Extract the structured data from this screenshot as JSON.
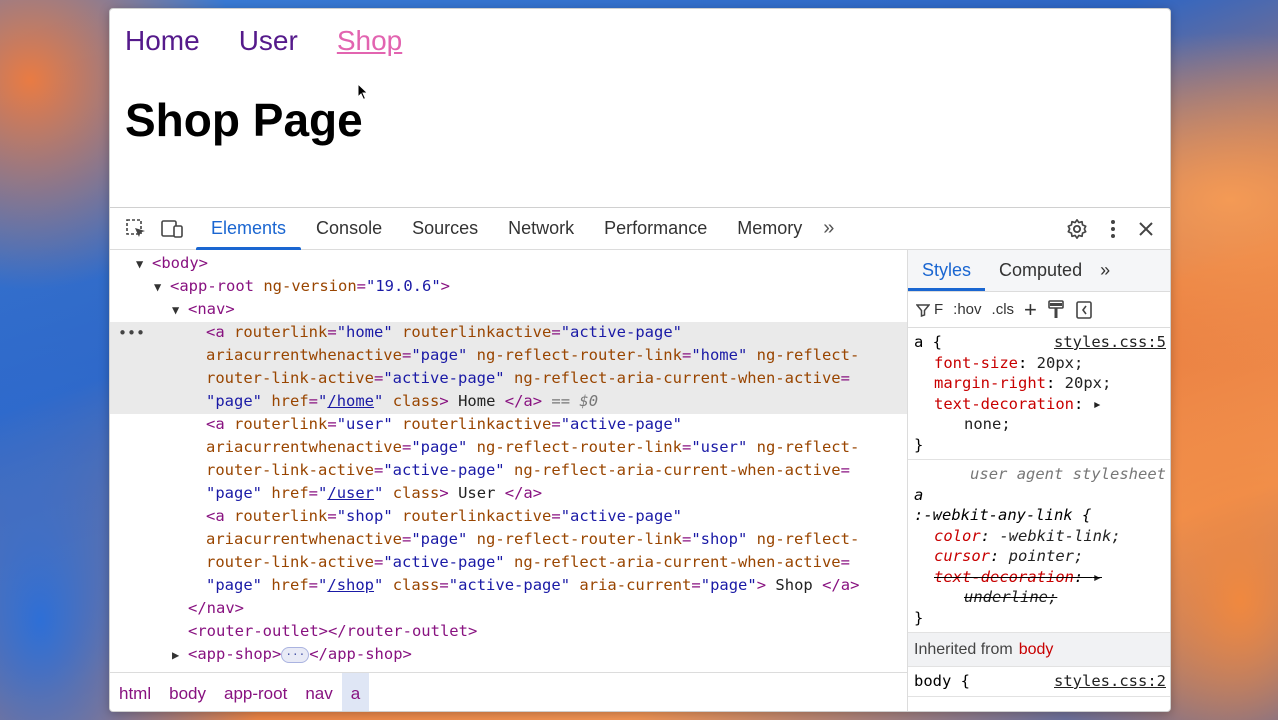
{
  "app": {
    "nav": [
      {
        "label": "Home",
        "active": false
      },
      {
        "label": "User",
        "active": false
      },
      {
        "label": "Shop",
        "active": true
      }
    ],
    "heading": "Shop Page"
  },
  "devtools": {
    "tabs": [
      {
        "label": "Elements",
        "active": true
      },
      {
        "label": "Console",
        "active": false
      },
      {
        "label": "Sources",
        "active": false
      },
      {
        "label": "Network",
        "active": false
      },
      {
        "label": "Performance",
        "active": false
      },
      {
        "label": "Memory",
        "active": false
      }
    ],
    "more_tabs": "»",
    "dom": {
      "body": "<body>",
      "app_root_open": "<app-root",
      "ng_version_attr": "ng-version",
      "ng_version_val": "\"19.0.6\"",
      "nav_open": "<nav>",
      "nav_close": "</nav>",
      "router_outlet": "<router-outlet></router-outlet>",
      "app_shop_open": "<app-shop>",
      "app_shop_close": "</app-shop>",
      "app_shop_ellipsis": "···",
      "selected_suffix": "== $0",
      "links": [
        {
          "routerlink": "\"home\"",
          "href": "/home",
          "class_val": "",
          "text": "Home"
        },
        {
          "routerlink": "\"user\"",
          "href": "/user",
          "class_val": "",
          "text": "User"
        },
        {
          "routerlink": "\"shop\"",
          "href": "/shop",
          "class_val": "\"active-page\"",
          "text": "Shop"
        }
      ]
    },
    "breadcrumbs": [
      "html",
      "body",
      "app-root",
      "nav",
      "a"
    ],
    "styles": {
      "tabs": [
        {
          "label": "Styles",
          "active": true
        },
        {
          "label": "Computed",
          "active": false
        }
      ],
      "toolbar": {
        "filter_prefix": "F",
        "hov": ":hov",
        "cls": ".cls",
        "add": "+"
      },
      "rule1": {
        "selector": "a {",
        "source": "styles.css:5",
        "props": [
          {
            "name": "font-size",
            "value": "20px;"
          },
          {
            "name": "margin-right",
            "value": "20px;"
          },
          {
            "name": "text-decoration",
            "value": "▸"
          }
        ],
        "continuation": "none;",
        "close": "}"
      },
      "ua_label": "user agent stylesheet",
      "rule2": {
        "selector_line1": "a",
        "selector_line2": ":-webkit-any-link {",
        "props": [
          {
            "name": "color",
            "value": "-webkit-link;"
          },
          {
            "name": "cursor",
            "value": "pointer;"
          },
          {
            "name": "text-decoration",
            "value": "▸"
          }
        ],
        "continuation": "underline;",
        "close": "}"
      },
      "inherited_label": "Inherited from",
      "inherited_tag": "body",
      "rule3": {
        "selector": "body {",
        "source": "styles.css:2"
      }
    }
  }
}
